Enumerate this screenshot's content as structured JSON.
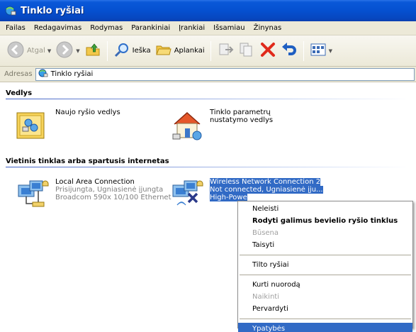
{
  "window": {
    "title": "Tinklo ryšiai",
    "title_bg": "#0550d0"
  },
  "menu": [
    "Failas",
    "Redagavimas",
    "Rodymas",
    "Parankiniai",
    "Įrankiai",
    "Išsamiau",
    "Žinynas"
  ],
  "toolbar": {
    "back_label": "Atgal",
    "search_label": "Ieška",
    "folders_label": "Aplankai"
  },
  "address": {
    "label": "Adresas",
    "value": "Tinklo ryšiai"
  },
  "groups": {
    "wizards": {
      "header": "Vedlys",
      "items": [
        {
          "title": "Naujo ryšio vedlys",
          "icon": "new-connection-wizard-icon"
        },
        {
          "title": "Tinklo parametrų nustatymo vedlys",
          "icon": "home-network-wizard-icon"
        }
      ]
    },
    "lan": {
      "header": "Vietinis tinklas arba spartusis internetas",
      "items": [
        {
          "title": "Local Area Connection",
          "line2": "Prisijungta, Ugniasienė įjungta",
          "line3": "Broadcom 590x 10/100 Ethernet",
          "icon": "lan-connection-icon"
        },
        {
          "title": "Wireless Network Connection 2",
          "line2": "Not connected, Ugniasienė įju...",
          "line3": "High-Powe",
          "icon": "wireless-connection-icon",
          "selected": true
        }
      ]
    }
  },
  "context_menu": {
    "items": [
      {
        "label": "Neleisti"
      },
      {
        "label": "Rodyti galimus bevielio ryšio tinklus",
        "bold": true
      },
      {
        "label": "Būsena",
        "disabled": true
      },
      {
        "label": "Taisyti"
      },
      {
        "label": "Tilto ryšiai"
      },
      {
        "label": "Kurti nuorodą"
      },
      {
        "label": "Naikinti",
        "disabled": true
      },
      {
        "label": "Pervardyti"
      },
      {
        "label": "Ypatybės",
        "highlighted": true
      }
    ]
  },
  "colors": {
    "selection": "#316ac5",
    "menubar_bg": "#ece9d8"
  }
}
